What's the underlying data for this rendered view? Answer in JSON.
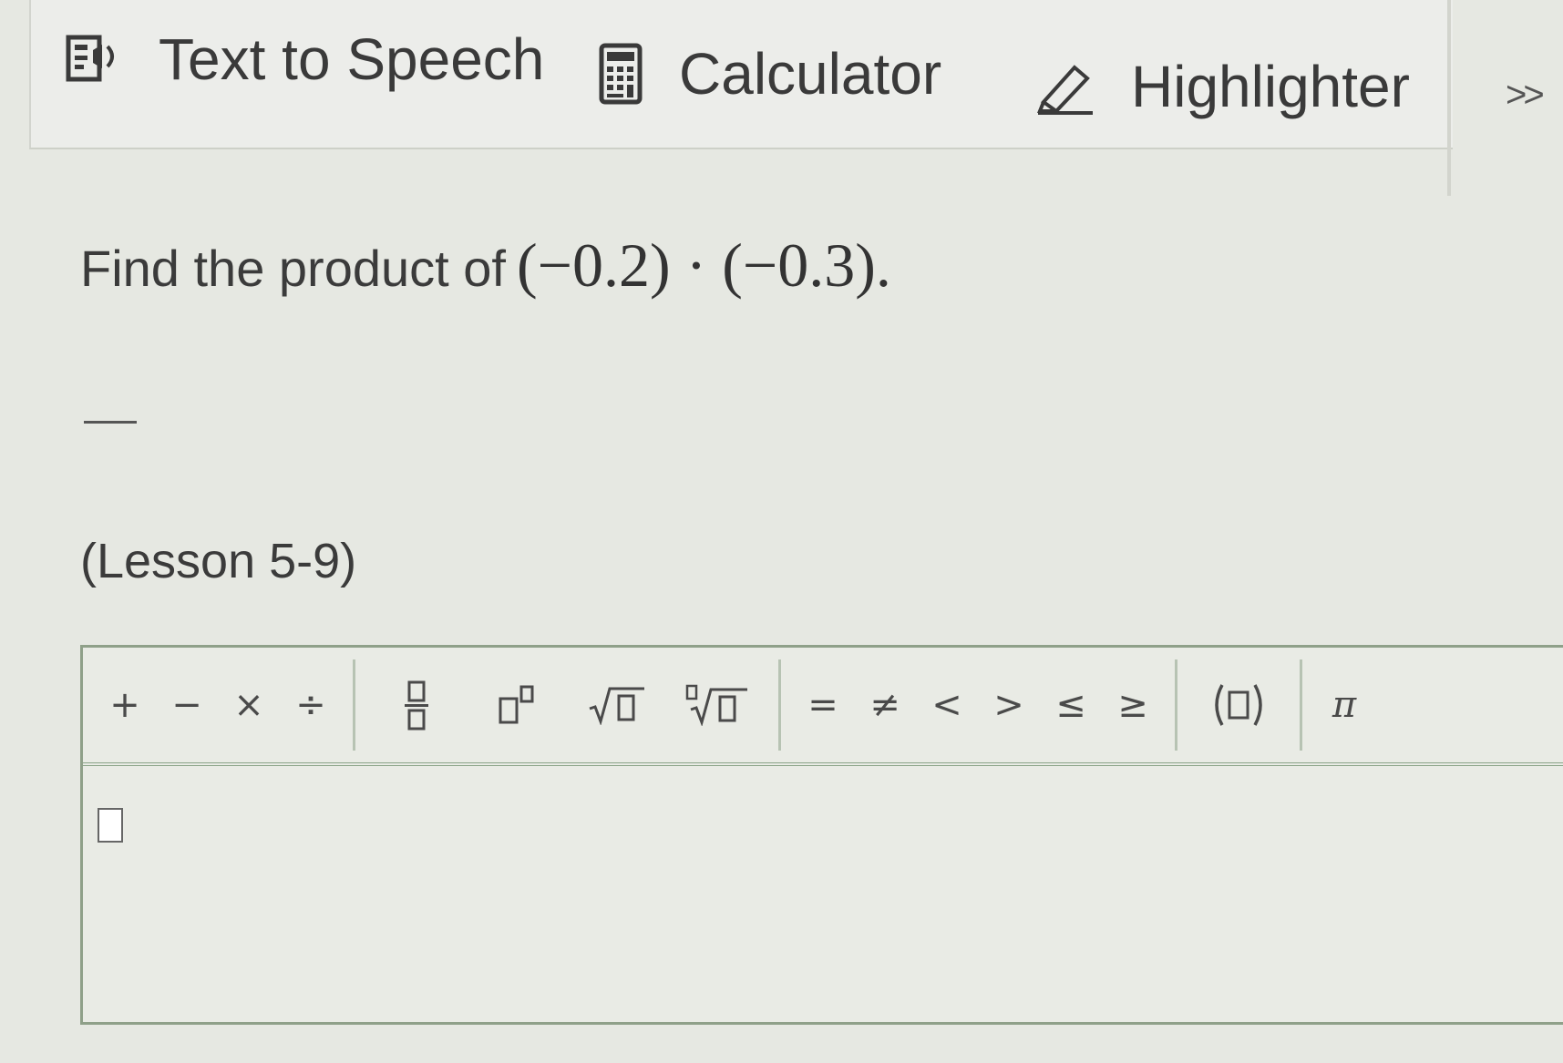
{
  "toolbar": {
    "tts_label": "Text to Speech",
    "calc_label": "Calculator",
    "highlight_label": "Highlighter",
    "more_label": ">>"
  },
  "question": {
    "prompt": "Find the product of",
    "expression": "(−0.2) · (−0.3)."
  },
  "lesson": "(Lesson 5-9)",
  "math_toolbar": {
    "ops": [
      "+",
      "−",
      "×",
      "÷"
    ],
    "relations": [
      "=",
      "≠",
      "<",
      ">",
      "≤",
      "≥"
    ],
    "pi": "π"
  },
  "colors": {
    "background": "#e6e8e2",
    "editor_border": "#8fa089",
    "text": "#3b3b3b"
  }
}
